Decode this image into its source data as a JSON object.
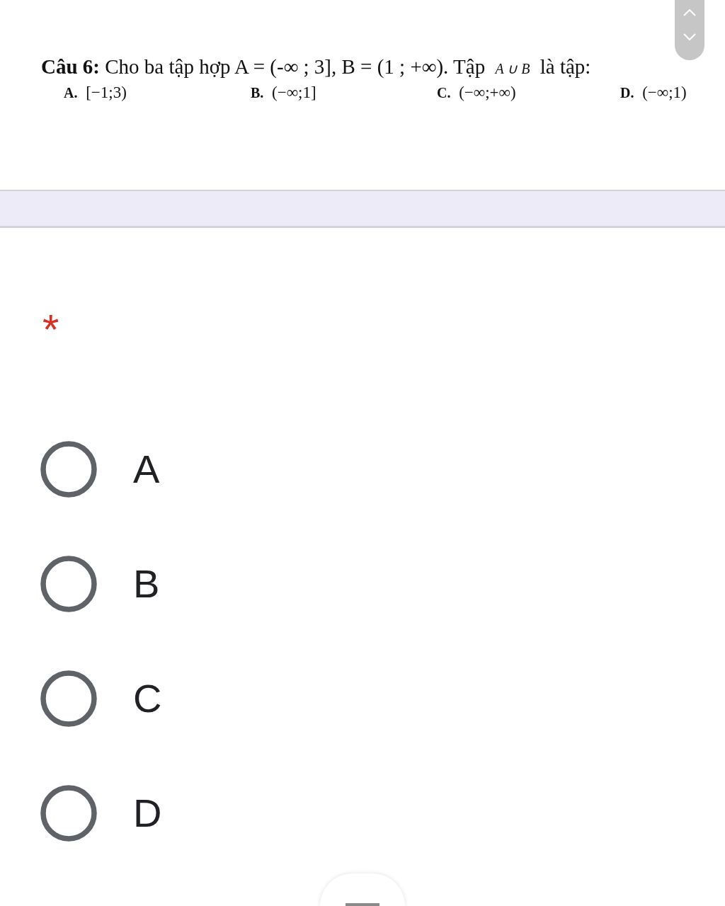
{
  "question": {
    "text": "**Câu 6:** Cho ba tập hợp A = (-∞ ; 3], B = (1 ; +∞). Tập *A ∪ B* là tập:",
    "choices": [
      "**A.** [−1;3)",
      "**B.** (−∞;1]",
      "**C.** (−∞;+∞)",
      "**D.** (−∞;1)"
    ]
  },
  "required_mark": "*",
  "options": [
    {
      "label": "A",
      "selected": false
    },
    {
      "label": "B",
      "selected": false
    },
    {
      "label": "C",
      "selected": false
    },
    {
      "label": "D",
      "selected": false
    }
  ]
}
